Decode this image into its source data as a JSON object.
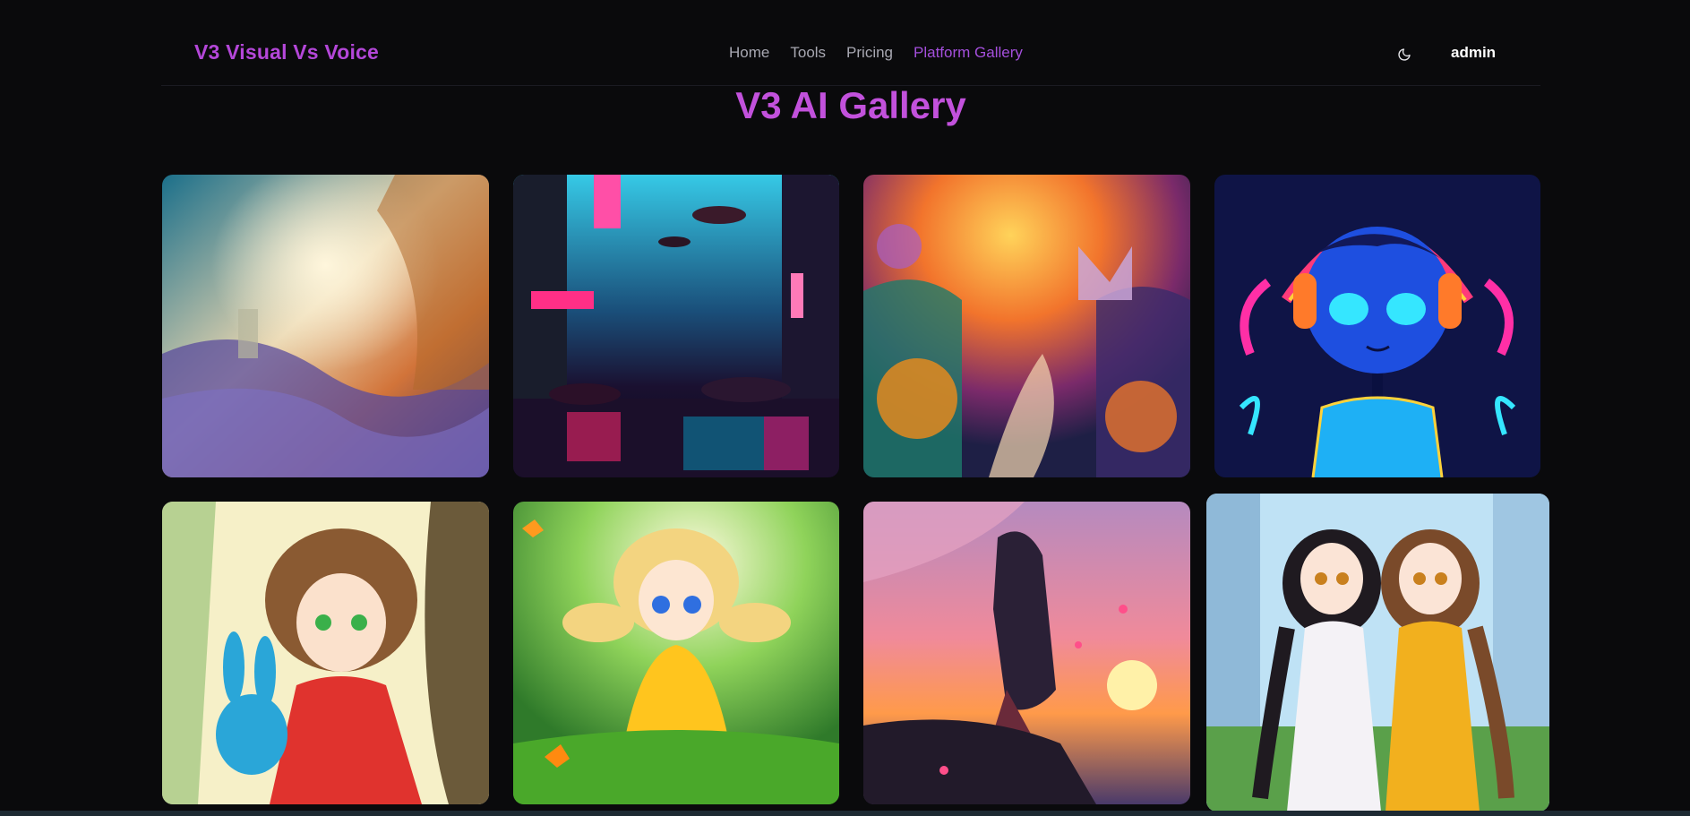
{
  "nav": {
    "brand": "V3 Visual Vs Voice",
    "links": [
      {
        "label": "Home",
        "active": false
      },
      {
        "label": "Tools",
        "active": false
      },
      {
        "label": "Pricing",
        "active": false
      },
      {
        "label": "Platform Gallery",
        "active": true
      }
    ],
    "theme_icon": "moon-icon",
    "user": "admin"
  },
  "gallery": {
    "title": "V3 AI Gallery",
    "images": [
      {
        "name": "swirling-fantasy-landscape-image"
      },
      {
        "name": "neon-cyberpunk-city-image"
      },
      {
        "name": "colorful-fairytale-forest-image"
      },
      {
        "name": "neon-headphones-character-image"
      },
      {
        "name": "anime-girl-with-bunny-image"
      },
      {
        "name": "anime-girl-in-meadow-image"
      },
      {
        "name": "anime-samurai-sunset-image"
      },
      {
        "name": "anime-two-girls-city-image"
      }
    ]
  },
  "colors": {
    "brand": "#b447d9",
    "active_link": "#a44fdc",
    "title": "#c251dc",
    "background": "#0a0a0c"
  }
}
